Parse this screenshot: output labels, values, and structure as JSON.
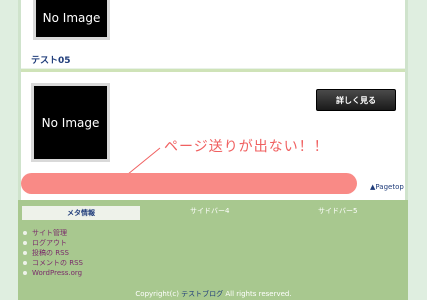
{
  "post": {
    "thumb_text_top": "No Image",
    "title": "テスト05",
    "thumb_text": "No Image",
    "more_button": "詳しく見る"
  },
  "annotation": {
    "text": "ページ送りが出ない！！"
  },
  "pagetop": "▲Pagetop",
  "footer": {
    "widgets": [
      "メタ情報",
      "サイドバー4",
      "サイドバー5"
    ],
    "meta_items": [
      "サイト管理",
      "ログアウト",
      "投稿の RSS",
      "コメントの RSS",
      "WordPress.org"
    ],
    "copyright_prefix": "Copyright(c) ",
    "blog_name": "テストブログ",
    "copyright_suffix": " All rights reserved."
  }
}
